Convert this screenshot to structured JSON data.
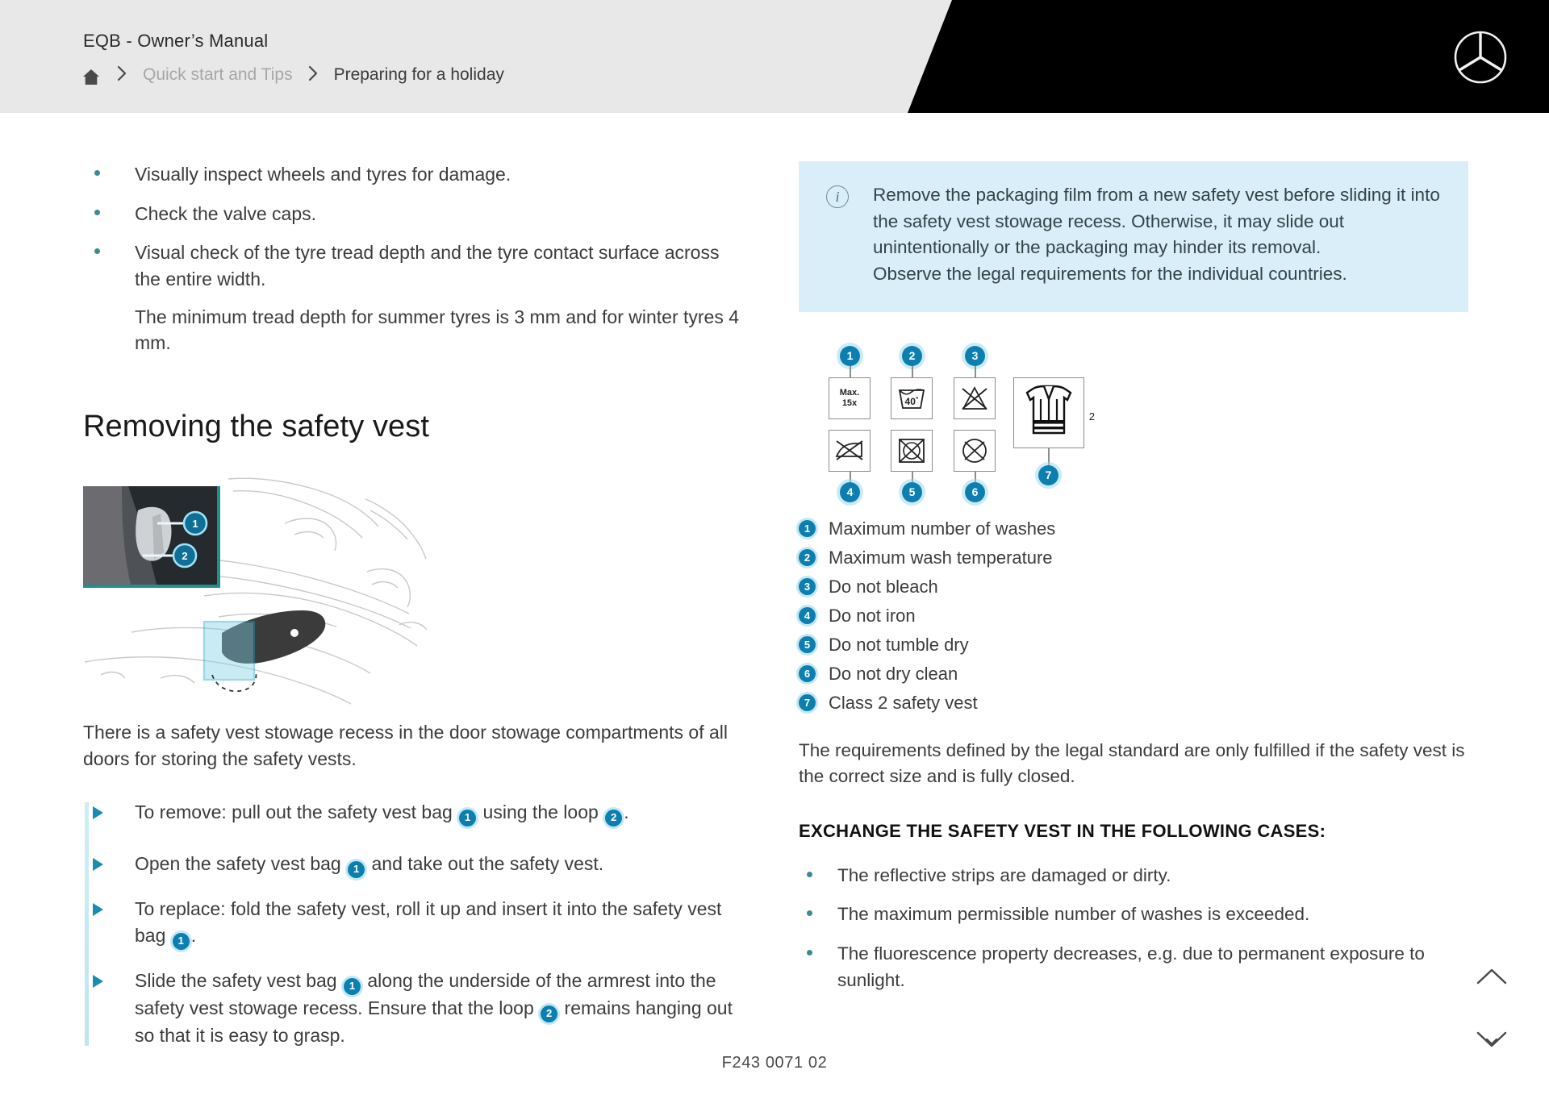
{
  "header": {
    "title": "EQB - Owner’s Manual",
    "home_icon": "home-icon",
    "separator": "›",
    "breadcrumb": [
      {
        "label": "Quick start and Tips",
        "muted": true
      },
      {
        "label": "Preparing for a holiday",
        "muted": false
      }
    ],
    "brand_logo": "mercedes-star-icon"
  },
  "left": {
    "checklist": [
      "Visually inspect wheels and tyres for damage.",
      "Check the valve caps.",
      "Visual check of the tyre tread depth and the tyre contact surface across the entire width."
    ],
    "checklist_subnote": "The minimum tread depth for summer tyres is 3 mm and for winter tyres 4 mm.",
    "section_title": "Removing the safety vest",
    "figure": {
      "name": "door-stowage-illustration",
      "callouts": [
        "1",
        "2"
      ]
    },
    "intro_paragraph": "There is a safety vest stowage recess in the door stowage compartments of all doors for storing the safety vests.",
    "actions": [
      {
        "parts": [
          "To remove: pull out the safety vest bag ",
          "1",
          " using the loop ",
          "2",
          "."
        ]
      },
      {
        "parts": [
          "Open the safety vest bag ",
          "1",
          " and take out the safety vest."
        ]
      },
      {
        "parts": [
          "To replace: fold the safety vest, roll it up and insert it into the safety vest bag ",
          "1",
          "."
        ]
      },
      {
        "parts": [
          "Slide the safety vest bag ",
          "1",
          " along the underside of the armrest into the safety vest stowage recess. Ensure that the loop ",
          "2",
          " remains hanging out so that it is easy to grasp."
        ]
      }
    ]
  },
  "right": {
    "info_box": {
      "icon": "info-icon",
      "text": "Remove the packaging film from a new safety vest before sliding it into the safety vest stowage recess. Otherwise, it may slide out unintentionally or the packaging may hinder its removal.\nObserve the legal requirements for the individual countries."
    },
    "symbols": {
      "max_washes_label": "Max.\n15x",
      "max_washes_line1": "Max.",
      "max_washes_line2": "15x",
      "wash_temp": "40",
      "wash_temp_unit": "°",
      "vest_class": "2",
      "badges": [
        "1",
        "2",
        "3",
        "4",
        "5",
        "6",
        "7"
      ]
    },
    "legend": [
      {
        "num": "1",
        "label": "Maximum number of washes"
      },
      {
        "num": "2",
        "label": "Maximum wash temperature"
      },
      {
        "num": "3",
        "label": "Do not bleach"
      },
      {
        "num": "4",
        "label": "Do not iron"
      },
      {
        "num": "5",
        "label": "Do not tumble dry"
      },
      {
        "num": "6",
        "label": "Do not dry clean"
      },
      {
        "num": "7",
        "label": "Class 2 safety vest"
      }
    ],
    "requirements_paragraph": "The requirements defined by the legal standard are only fulfilled if the safety vest is the correct size and is fully closed.",
    "cases_title": "EXCHANGE THE SAFETY VEST IN THE FOLLOWING CASES:",
    "cases": [
      "The reflective strips are damaged or dirty.",
      "The maximum permissible number of washes is exceeded.",
      "The fluorescence property decreases, e.g. due to permanent exposure to sunlight."
    ]
  },
  "footer": {
    "code": "F243 0071 02"
  },
  "nav": {
    "up_icon": "chevron-up-icon",
    "down_icon": "arrow-down-collapse-icon"
  },
  "colors": {
    "accent_blue": "#0c7fb0",
    "info_bg": "#d9eef8",
    "header_bg": "#e8e8e8",
    "bullet_teal": "#3c8a93"
  }
}
